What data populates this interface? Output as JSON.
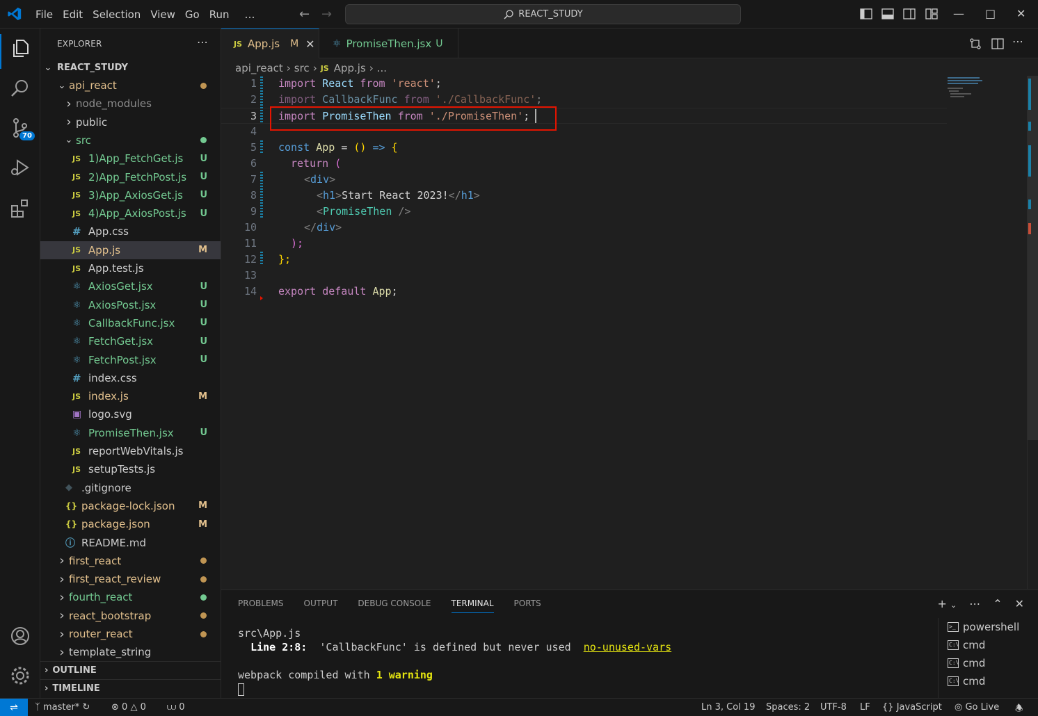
{
  "menu": [
    "File",
    "Edit",
    "Selection",
    "View",
    "Go",
    "Run",
    "…"
  ],
  "search": {
    "text": "REACT_STUDY"
  },
  "sidebar": {
    "title": "EXPLORER",
    "root": "REACT_STUDY",
    "rows": [
      {
        "name": "api_react",
        "type": "folder",
        "open": true,
        "indent": 1,
        "color": "#e2c08d",
        "dot": "#c09553"
      },
      {
        "name": "node_modules",
        "type": "folder",
        "open": false,
        "indent": 2,
        "color": "#8c8c8c"
      },
      {
        "name": "public",
        "type": "folder",
        "open": false,
        "indent": 2,
        "color": "#cccccc"
      },
      {
        "name": "src",
        "type": "folder",
        "open": true,
        "indent": 2,
        "color": "#73c991",
        "dot": "#73c991"
      },
      {
        "name": "1)App_FetchGet.js",
        "type": "js",
        "indent": 3,
        "color": "#73c991",
        "status": "U"
      },
      {
        "name": "2)App_FetchPost.js",
        "type": "js",
        "indent": 3,
        "color": "#73c991",
        "status": "U"
      },
      {
        "name": "3)App_AxiosGet.js",
        "type": "js",
        "indent": 3,
        "color": "#73c991",
        "status": "U"
      },
      {
        "name": "4)App_AxiosPost.js",
        "type": "js",
        "indent": 3,
        "color": "#73c991",
        "status": "U"
      },
      {
        "name": "App.css",
        "type": "css",
        "indent": 3,
        "color": "#cccccc"
      },
      {
        "name": "App.js",
        "type": "js",
        "indent": 3,
        "color": "#e2c08d",
        "status": "M",
        "selected": true
      },
      {
        "name": "App.test.js",
        "type": "js",
        "indent": 3,
        "color": "#cccccc"
      },
      {
        "name": "AxiosGet.jsx",
        "type": "react",
        "indent": 3,
        "color": "#73c991",
        "status": "U"
      },
      {
        "name": "AxiosPost.jsx",
        "type": "react",
        "indent": 3,
        "color": "#73c991",
        "status": "U"
      },
      {
        "name": "CallbackFunc.jsx",
        "type": "react",
        "indent": 3,
        "color": "#73c991",
        "status": "U"
      },
      {
        "name": "FetchGet.jsx",
        "type": "react",
        "indent": 3,
        "color": "#73c991",
        "status": "U"
      },
      {
        "name": "FetchPost.jsx",
        "type": "react",
        "indent": 3,
        "color": "#73c991",
        "status": "U"
      },
      {
        "name": "index.css",
        "type": "css",
        "indent": 3,
        "color": "#cccccc"
      },
      {
        "name": "index.js",
        "type": "js",
        "indent": 3,
        "color": "#e2c08d",
        "status": "M"
      },
      {
        "name": "logo.svg",
        "type": "svg",
        "indent": 3,
        "color": "#cccccc"
      },
      {
        "name": "PromiseThen.jsx",
        "type": "react",
        "indent": 3,
        "color": "#73c991",
        "status": "U"
      },
      {
        "name": "reportWebVitals.js",
        "type": "js",
        "indent": 3,
        "color": "#cccccc"
      },
      {
        "name": "setupTests.js",
        "type": "js",
        "indent": 3,
        "color": "#cccccc"
      },
      {
        "name": ".gitignore",
        "type": "git",
        "indent": 2,
        "color": "#cccccc"
      },
      {
        "name": "package-lock.json",
        "type": "json",
        "indent": 2,
        "color": "#e2c08d",
        "status": "M"
      },
      {
        "name": "package.json",
        "type": "json",
        "indent": 2,
        "color": "#e2c08d",
        "status": "M"
      },
      {
        "name": "README.md",
        "type": "info",
        "indent": 2,
        "color": "#cccccc"
      },
      {
        "name": "first_react",
        "type": "folder",
        "open": false,
        "indent": 1,
        "color": "#e2c08d",
        "dot": "#c09553"
      },
      {
        "name": "first_react_review",
        "type": "folder",
        "open": false,
        "indent": 1,
        "color": "#e2c08d",
        "dot": "#c09553"
      },
      {
        "name": "fourth_react",
        "type": "folder",
        "open": false,
        "indent": 1,
        "color": "#73c991",
        "dot": "#73c991"
      },
      {
        "name": "react_bootstrap",
        "type": "folder",
        "open": false,
        "indent": 1,
        "color": "#e2c08d",
        "dot": "#c09553"
      },
      {
        "name": "router_react",
        "type": "folder",
        "open": false,
        "indent": 1,
        "color": "#e2c08d",
        "dot": "#c09553"
      },
      {
        "name": "template_string",
        "type": "folder",
        "open": false,
        "indent": 1,
        "color": "#cccccc"
      }
    ],
    "outline": "OUTLINE",
    "timeline": "TIMELINE"
  },
  "activity": {
    "scm_badge": "70"
  },
  "tabs": [
    {
      "label": "App.js",
      "status": "M",
      "type": "js",
      "active": true,
      "color": "#e2c08d"
    },
    {
      "label": "PromiseThen.jsx",
      "status": "U",
      "type": "react",
      "active": false,
      "color": "#73c991"
    }
  ],
  "breadcrumb": [
    "api_react",
    "src",
    "App.js",
    "..."
  ],
  "code": {
    "lines": [
      "1",
      "2",
      "3",
      "4",
      "5",
      "6",
      "7",
      "8",
      "9",
      "10",
      "11",
      "12",
      "13",
      "14"
    ],
    "current_line": 3,
    "tokens": {
      "l1": [
        "import",
        "React",
        "from",
        "'react'",
        ";"
      ],
      "l2": [
        "import",
        "CallbackFunc",
        "from",
        "'./CallbackFunc'",
        ";"
      ],
      "l3": [
        "import",
        "PromiseThen",
        "from",
        "'./PromiseThen'",
        ";"
      ],
      "l5": [
        "const",
        "App",
        "=",
        "()",
        "=>",
        "{"
      ],
      "l6": [
        "return",
        "("
      ],
      "l7": [
        "<",
        "div",
        ">"
      ],
      "l8": [
        "<",
        "h1",
        ">",
        "Start React 2023!",
        "</",
        "h1",
        ">"
      ],
      "l9": [
        "<",
        "PromiseThen",
        " />"
      ],
      "l10": [
        "</",
        "div",
        ">"
      ],
      "l11": [
        ");"
      ],
      "l12": [
        "};"
      ],
      "l14": [
        "export",
        "default",
        "App",
        ";"
      ]
    }
  },
  "panel": {
    "tabs": [
      "PROBLEMS",
      "OUTPUT",
      "DEBUG CONSOLE",
      "TERMINAL",
      "PORTS"
    ],
    "active_tab": "TERMINAL",
    "terminal": {
      "line1": "src\\App.js",
      "line2_loc": "Line 2:8:",
      "line2_msg": "'CallbackFunc' is defined but never used",
      "line2_rule": "no-unused-vars",
      "line3_pre": "webpack compiled with ",
      "line3_count": "1",
      "line3_post": "warning"
    },
    "terminals": [
      "powershell",
      "cmd",
      "cmd",
      "cmd"
    ]
  },
  "status": {
    "branch": "master*",
    "errors": "0",
    "warnings": "0",
    "ports": "0",
    "position": "Ln 3, Col 19",
    "spaces": "Spaces: 2",
    "encoding": "UTF-8",
    "eol": "LF",
    "language": "JavaScript",
    "live": "Go Live"
  },
  "colors": {
    "accent": "#0078d4",
    "highlight_box": "#e51400",
    "modified": "#e2c08d",
    "untracked": "#73c991"
  }
}
